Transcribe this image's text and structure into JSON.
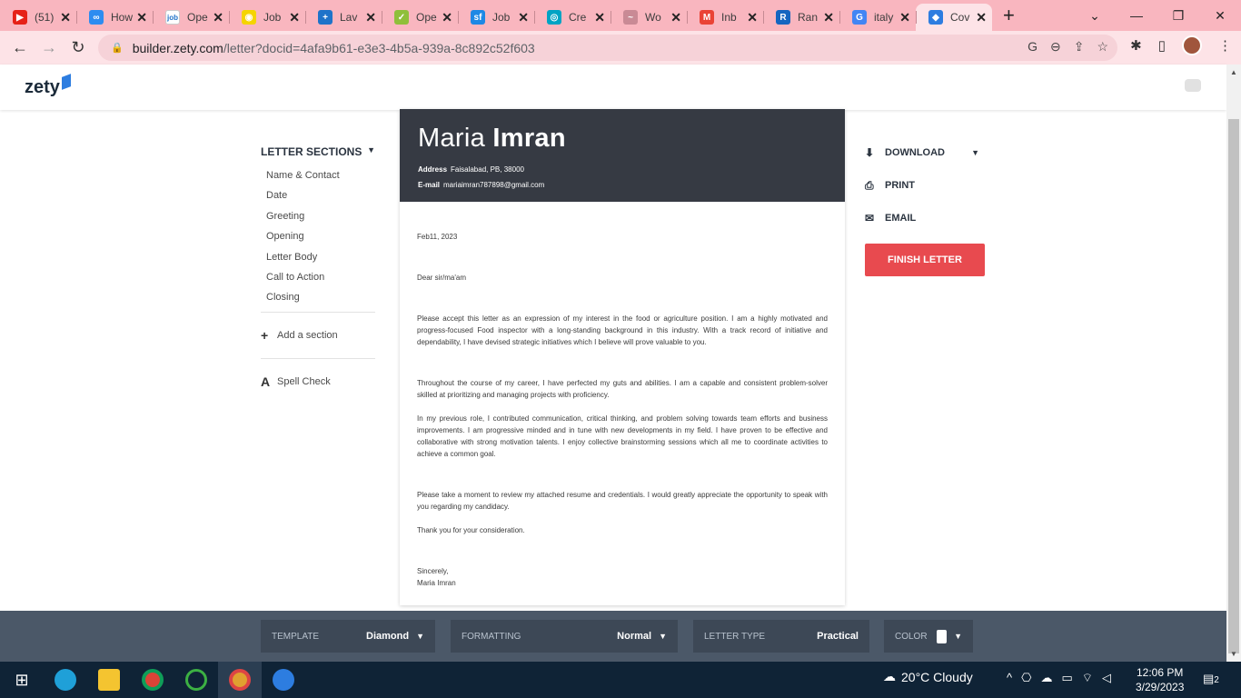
{
  "browser": {
    "tabs": [
      {
        "title": "(51)",
        "favicon_color": "#e62117",
        "favicon_char": "▶"
      },
      {
        "title": "How",
        "favicon_color": "#2d8cf0",
        "favicon_char": "∞"
      },
      {
        "title": "Ope",
        "favicon_color": "#ffffff",
        "favicon_char": "job"
      },
      {
        "title": "Job",
        "favicon_color": "#f5d400",
        "favicon_char": "◉"
      },
      {
        "title": "Lav",
        "favicon_color": "#1e73c9",
        "favicon_char": "+"
      },
      {
        "title": "Ope",
        "favicon_color": "#8fbf3a",
        "favicon_char": "✓"
      },
      {
        "title": "Job",
        "favicon_color": "#1e88e5",
        "favicon_char": "sf"
      },
      {
        "title": "Cre",
        "favicon_color": "#00a3c4",
        "favicon_char": "◎"
      },
      {
        "title": "Wo",
        "favicon_color": "#c98a95",
        "favicon_char": "~"
      },
      {
        "title": "Inb",
        "favicon_color": "#ea4335",
        "favicon_char": "M"
      },
      {
        "title": "Ran",
        "favicon_color": "#1565c0",
        "favicon_char": "R"
      },
      {
        "title": "italy",
        "favicon_color": "#4285f4",
        "favicon_char": "G"
      },
      {
        "title": "Cov",
        "favicon_color": "#2d7de0",
        "favicon_char": "◆"
      }
    ],
    "url_host": "builder.zety.com",
    "url_path": "/letter?docid=4afa9b61-e3e3-4b5a-939a-8c892c52f603"
  },
  "app": {
    "logo": "zety"
  },
  "sidebar": {
    "title": "LETTER SECTIONS",
    "items": [
      "Name & Contact",
      "Date",
      "Greeting",
      "Opening",
      "Letter Body",
      "Call to Action",
      "Closing"
    ],
    "add_section": "Add a section",
    "spell_check": "Spell Check"
  },
  "letter": {
    "first_name": "Maria",
    "last_name": "Imran",
    "address_label": "Address",
    "address": "Faisalabad, PB, 38000",
    "email_label": "E-mail",
    "email": "mariaimran787898@gmail.com",
    "date": "Feb11, 2023",
    "greeting": "Dear sir/ma'am",
    "opening": "Please accept this letter as an expression of my interest in the food or agriculture position. I am a highly motivated and progress-focused Food inspector with a long-standing background in this industry. With a track record of initiative and dependability, I have devised strategic initiatives which I believe will prove valuable to you.",
    "body1": "Throughout the course of my career, I have perfected my guts and abilities. I am a capable and consistent problem-solver skilled at prioritizing and managing projects with proficiency.",
    "body2": "In my previous role, I contributed communication, critical thinking, and problem solving towards team efforts and business improvements. I am progressive minded and in tune with new developments in my field. I have proven to be effective and collaborative with strong motivation talents. I enjoy collective brainstorming sessions which all me to coordinate activities to achieve a common goal.",
    "call_to_action": "Please take a moment to review my attached resume and credentials. I would greatly appreciate the opportunity to speak with you regarding my candidacy.",
    "thanks": "Thank you for your consideration.",
    "signoff": "Sincerely,",
    "signature": "Maria Imran"
  },
  "actions": {
    "download": "DOWNLOAD",
    "print": "PRINT",
    "email": "EMAIL",
    "finish": "FINISH LETTER"
  },
  "config": {
    "template_label": "TEMPLATE",
    "template_value": "Diamond",
    "formatting_label": "FORMATTING",
    "formatting_value": "Normal",
    "letter_type_label": "LETTER TYPE",
    "letter_type_value": "Practical",
    "color_label": "COLOR"
  },
  "taskbar": {
    "weather": "20°C  Cloudy",
    "time": "12:06 PM",
    "date": "3/29/2023",
    "notifications": "2"
  }
}
